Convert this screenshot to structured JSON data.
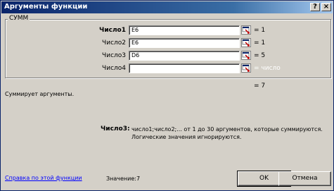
{
  "window": {
    "title": "Аргументы функции",
    "help_button": "?",
    "close_button": "×"
  },
  "function": {
    "group_label": "СУММ",
    "arguments": [
      {
        "label": "Число1",
        "value": "E6",
        "result": "= 1",
        "active": true
      },
      {
        "label": "Число2",
        "value": "E6",
        "result": "= 1",
        "active": false
      },
      {
        "label": "Число3",
        "value": "D6",
        "result": "= 5",
        "active": false
      },
      {
        "label": "Число4",
        "value": "",
        "result": "= число",
        "active": false
      }
    ],
    "total_result": "= 7",
    "description": "Суммирует аргументы.",
    "arg_help_title": "Число3:",
    "arg_help_line1": "число1;число2;... от 1 до 30 аргументов, которые суммируются.",
    "arg_help_line2": "Логические значения игнорируются."
  },
  "footer": {
    "help_link": "Справка по этой функции",
    "value_label": "Значение:",
    "value": "7",
    "ok_label": "OK",
    "cancel_label": "Отмена"
  }
}
